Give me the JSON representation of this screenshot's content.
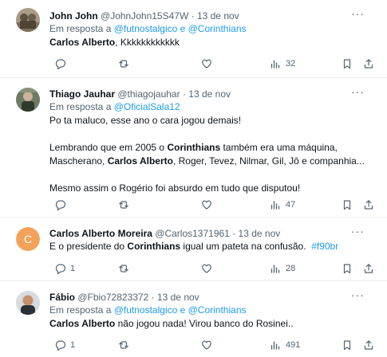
{
  "tweets": [
    {
      "name": "John John",
      "handle": "@JohnJohn15S47W",
      "dot": "·",
      "date": "13 de nov",
      "reply_prefix": "Em resposta a",
      "reply_mentions": "@futnostalgico e @Corinthians",
      "lines": [
        [
          {
            "b": "Carlos Alberto"
          },
          {
            "t": ", Kkkkkkkkkkkk"
          }
        ]
      ],
      "reply_count": "",
      "retweet_count": "",
      "like_count": "",
      "view_count": "32",
      "avatar": "sepia-photo"
    },
    {
      "name": "Thiago Jauhar",
      "handle": "@thiagojauhar",
      "dot": "·",
      "date": "13 de nov",
      "reply_prefix": "Em resposta a",
      "reply_mentions": "@OficialSala12",
      "lines": [
        [
          {
            "t": "Po ta maluco, esse ano o cara jogou demais!"
          }
        ],
        [],
        [
          {
            "t": "Lembrando que em 2005 o "
          },
          {
            "b": "Corinthians"
          },
          {
            "t": " também era uma máquina,"
          }
        ],
        [
          {
            "t": "Mascherano, "
          },
          {
            "b": "Carlos Alberto"
          },
          {
            "t": ", Roger, Tevez, Nilmar, Gil, Jô e companhia..."
          }
        ],
        [],
        [
          {
            "t": "Mesmo assim o Rogério foi absurdo em tudo que disputou!"
          }
        ]
      ],
      "reply_count": "",
      "retweet_count": "",
      "like_count": "",
      "view_count": "47",
      "avatar": "green-photo"
    },
    {
      "name": "Carlos Alberto Moreira",
      "handle": "@Carlos1371961",
      "dot": "·",
      "date": "13 de nov",
      "reply_prefix": "",
      "reply_mentions": "",
      "lines": [
        [
          {
            "t": "E o presidente do "
          },
          {
            "b": "Corinthians"
          },
          {
            "t": " igual um pateta na confusão.  "
          },
          {
            "h": "#f90br"
          }
        ]
      ],
      "reply_count": "1",
      "retweet_count": "",
      "like_count": "",
      "view_count": "28",
      "avatar": "letter",
      "avatar_letter": "C",
      "avatar_color": "#f4a25b"
    },
    {
      "name": "Fábio",
      "handle": "@Fbio72823372",
      "dot": "·",
      "date": "13 de nov",
      "reply_prefix": "Em resposta a",
      "reply_mentions": "@futnostalgico e @Corinthians",
      "lines": [
        [
          {
            "b": "Carlos Alberto"
          },
          {
            "t": " não jogou nada! Virou banco do Rosinei.."
          }
        ]
      ],
      "reply_count": "1",
      "retweet_count": "",
      "like_count": "",
      "view_count": "491",
      "avatar": "man-photo"
    }
  ],
  "icons": {
    "reply": "reply-icon",
    "retweet": "retweet-icon",
    "like": "heart-icon",
    "views": "analytics-icon",
    "bookmark": "bookmark-icon",
    "share": "share-icon",
    "more": "more-icon"
  },
  "colors": {
    "link": "#1d9bf0",
    "secondary": "#536471",
    "divider": "#e6ecf0",
    "avatar_letter_bg": "#f4a25b"
  }
}
